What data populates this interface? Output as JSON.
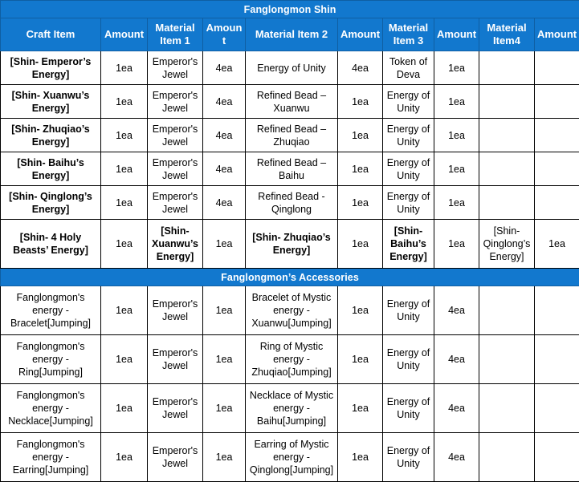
{
  "title": "Fanglongmon Shin",
  "columns": [
    "Craft Item",
    "Amount",
    "Material Item 1",
    "Amount",
    "Material Item 2",
    "Amount",
    "Material Item 3",
    "Amount",
    "Material Item4",
    "Amount"
  ],
  "colors": {
    "header_blue": "#1278CE",
    "header_border": "#0F5FA3",
    "header_text": "#FFFFFF",
    "cell_border": "#000000",
    "cell_background": "#FFFFFF",
    "cell_text": "#000000"
  },
  "sections": [
    {
      "band": "Fanglongmon Shin",
      "rows": [
        {
          "craft_item": "[Shin- Emperor’s Energy]",
          "amount1": "1ea",
          "material1": "Emperor's Jewel",
          "amount2": "4ea",
          "material2": "Energy of Unity",
          "amount3": "4ea",
          "material3": "Token of Deva",
          "amount4": "1ea",
          "material4": "",
          "amount5": ""
        },
        {
          "craft_item": "[Shin- Xuanwu’s Energy]",
          "amount1": "1ea",
          "material1": "Emperor's Jewel",
          "amount2": "4ea",
          "material2": "Refined Bead – Xuanwu",
          "amount3": "1ea",
          "material3": "Energy of Unity",
          "amount4": "1ea",
          "material4": "",
          "amount5": ""
        },
        {
          "craft_item": "[Shin- Zhuqiao’s Energy]",
          "amount1": "1ea",
          "material1": "Emperor's Jewel",
          "amount2": "4ea",
          "material2": "Refined Bead – Zhuqiao",
          "amount3": "1ea",
          "material3": "Energy of Unity",
          "amount4": "1ea",
          "material4": "",
          "amount5": ""
        },
        {
          "craft_item": "[Shin- Baihu’s Energy]",
          "amount1": "1ea",
          "material1": "Emperor's Jewel",
          "amount2": "4ea",
          "material2": "Refined Bead – Baihu",
          "amount3": "1ea",
          "material3": "Energy of Unity",
          "amount4": "1ea",
          "material4": "",
          "amount5": ""
        },
        {
          "craft_item": "[Shin- Qinglong’s Energy]",
          "amount1": "1ea",
          "material1": "Emperor's Jewel",
          "amount2": "4ea",
          "material2": "Refined Bead - Qinglong",
          "amount3": "1ea",
          "material3": "Energy of Unity",
          "amount4": "1ea",
          "material4": "",
          "amount5": ""
        },
        {
          "craft_item": "[Shin- 4 Holy Beasts’ Energy]",
          "amount1": "1ea",
          "material1": "[Shin- Xuanwu’s Energy]",
          "amount2": "1ea",
          "material2": "[Shin- Zhuqiao’s Energy]",
          "amount3": "1ea",
          "material3": "[Shin- Baihu’s Energy]",
          "amount4": "1ea",
          "material4": "[Shin- Qinglong’s Energy]",
          "amount5": "1ea"
        }
      ]
    },
    {
      "band": "Fanglongmon’s Accessories",
      "rows": [
        {
          "craft_item": "Fanglongmon's energy - Bracelet[Jumping]",
          "amount1": "1ea",
          "material1": "Emperor's Jewel",
          "amount2": "1ea",
          "material2": "Bracelet of Mystic energy - Xuanwu[Jumping]",
          "amount3": "1ea",
          "material3": "Energy of Unity",
          "amount4": "4ea",
          "material4": "",
          "amount5": ""
        },
        {
          "craft_item": "Fanglongmon's energy - Ring[Jumping]",
          "amount1": "1ea",
          "material1": "Emperor's Jewel",
          "amount2": "1ea",
          "material2": "Ring of Mystic energy - Zhuqiao[Jumping]",
          "amount3": "1ea",
          "material3": "Energy of Unity",
          "amount4": "4ea",
          "material4": "",
          "amount5": ""
        },
        {
          "craft_item": "Fanglongmon's energy - Necklace[Jumping]",
          "amount1": "1ea",
          "material1": "Emperor's Jewel",
          "amount2": "1ea",
          "material2": "Necklace of Mystic energy - Baihu[Jumping]",
          "amount3": "1ea",
          "material3": "Energy of Unity",
          "amount4": "4ea",
          "material4": "",
          "amount5": ""
        },
        {
          "craft_item": "Fanglongmon's energy - Earring[Jumping]",
          "amount1": "1ea",
          "material1": "Emperor's Jewel",
          "amount2": "1ea",
          "material2": "Earring of Mystic energy - Qinglong[Jumping]",
          "amount3": "1ea",
          "material3": "Energy of Unity",
          "amount4": "4ea",
          "material4": "",
          "amount5": ""
        }
      ]
    }
  ]
}
